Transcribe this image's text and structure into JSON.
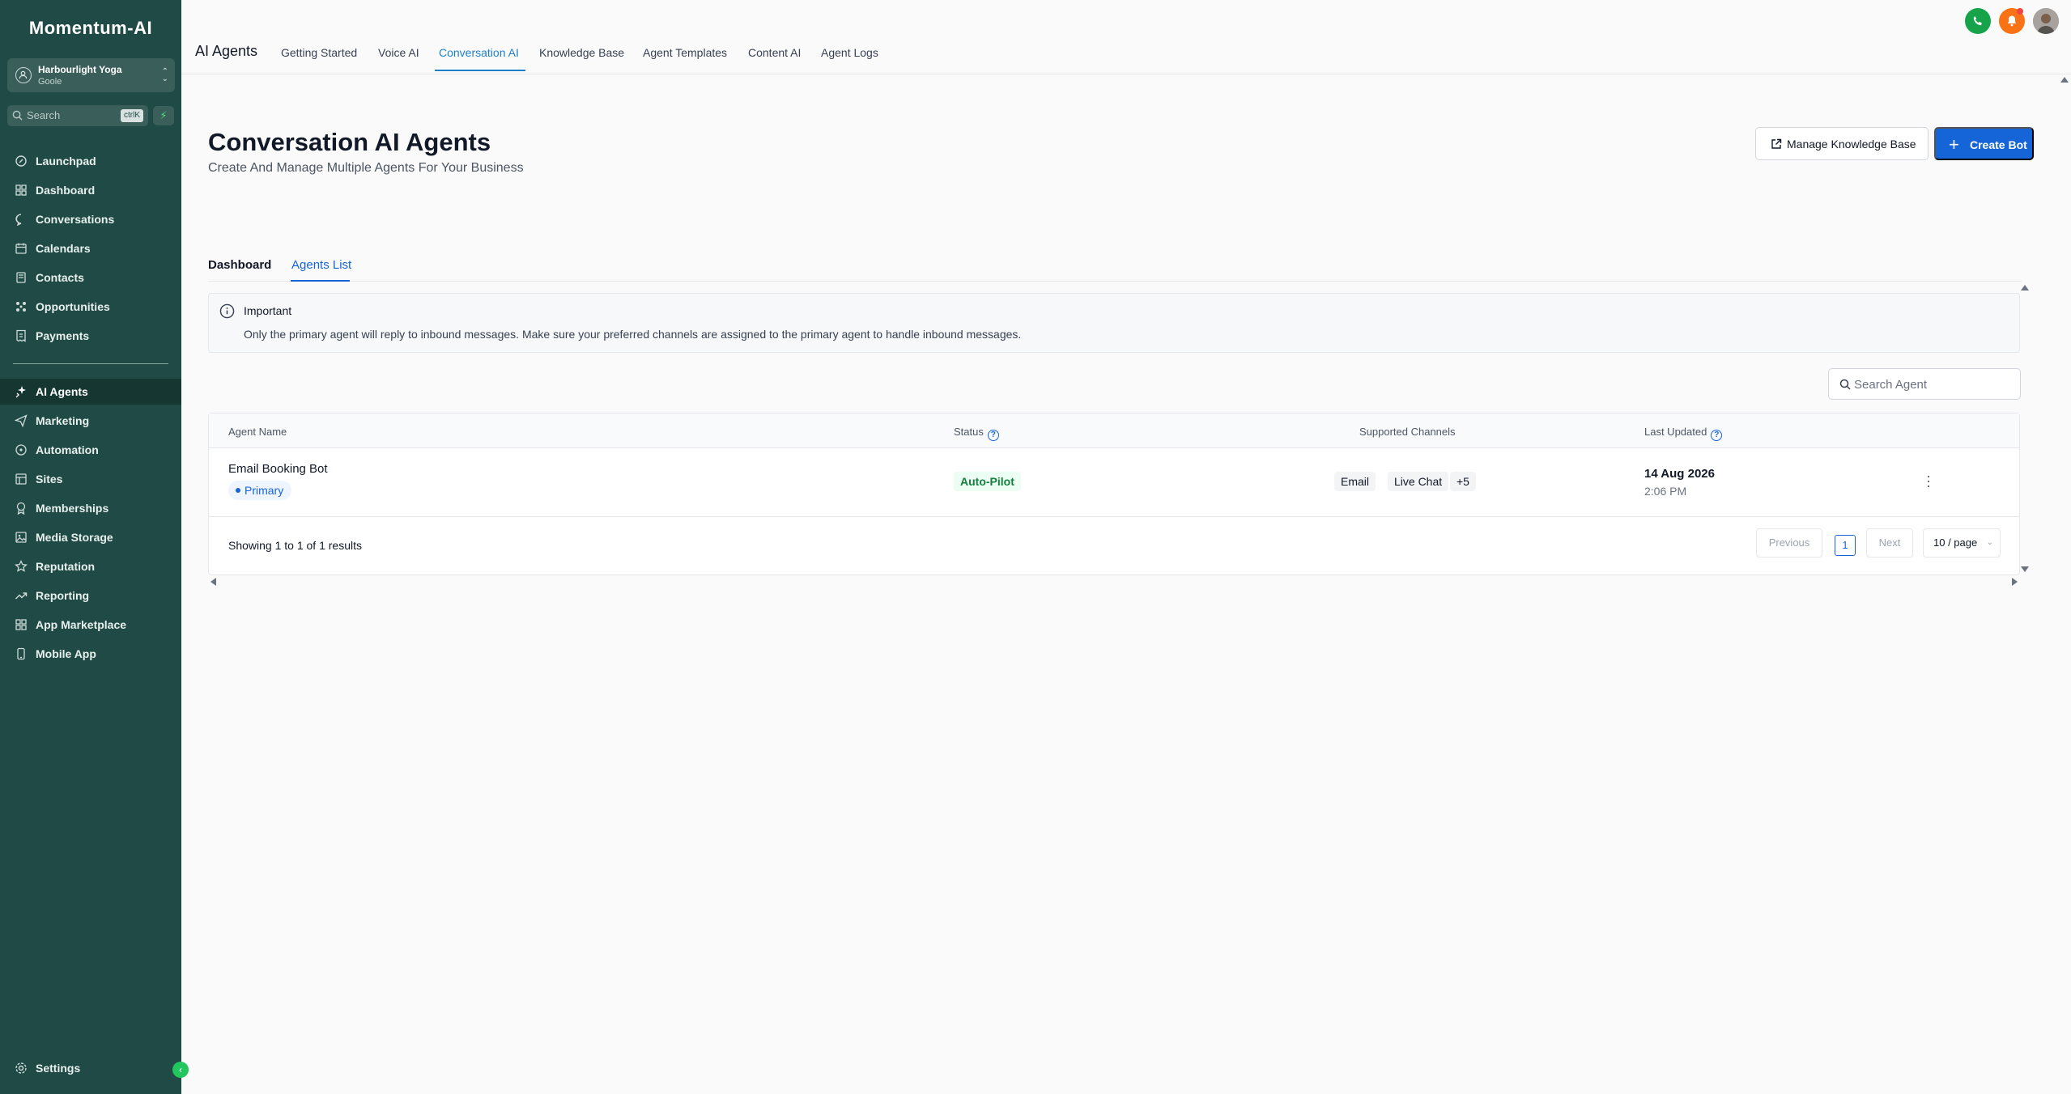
{
  "app": {
    "logo": "Momentum-AI"
  },
  "account": {
    "name": "Harbourlight Yoga",
    "location": "Goole"
  },
  "sidebar": {
    "search_placeholder": "Search",
    "search_shortcut": "ctrlK",
    "items": [
      {
        "label": "Launchpad",
        "icon": "rocket-icon"
      },
      {
        "label": "Dashboard",
        "icon": "grid-icon"
      },
      {
        "label": "Conversations",
        "icon": "chat-bubble-icon"
      },
      {
        "label": "Calendars",
        "icon": "calendar-icon"
      },
      {
        "label": "Contacts",
        "icon": "contacts-icon"
      },
      {
        "label": "Opportunities",
        "icon": "opportunities-icon"
      },
      {
        "label": "Payments",
        "icon": "receipt-icon"
      },
      {
        "label": "AI Agents",
        "icon": "sparkle-icon",
        "active": true
      },
      {
        "label": "Marketing",
        "icon": "send-icon"
      },
      {
        "label": "Automation",
        "icon": "automation-icon"
      },
      {
        "label": "Sites",
        "icon": "sites-icon"
      },
      {
        "label": "Memberships",
        "icon": "award-icon"
      },
      {
        "label": "Media Storage",
        "icon": "image-icon"
      },
      {
        "label": "Reputation",
        "icon": "star-icon"
      },
      {
        "label": "Reporting",
        "icon": "trend-icon"
      },
      {
        "label": "App Marketplace",
        "icon": "apps-icon"
      },
      {
        "label": "Mobile App",
        "icon": "mobile-icon"
      }
    ],
    "settings_label": "Settings"
  },
  "topbar": {
    "title": "AI Agents",
    "tabs": [
      {
        "label": "Getting Started"
      },
      {
        "label": "Voice AI"
      },
      {
        "label": "Conversation AI",
        "active": true
      },
      {
        "label": "Knowledge Base"
      },
      {
        "label": "Agent Templates"
      },
      {
        "label": "Content AI"
      },
      {
        "label": "Agent Logs"
      }
    ]
  },
  "page": {
    "title": "Conversation AI Agents",
    "subtitle": "Create And Manage Multiple Agents For Your Business",
    "manage_kb_label": "Manage Knowledge Base",
    "create_bot_label": "Create Bot",
    "subtabs": [
      {
        "label": "Dashboard"
      },
      {
        "label": "Agents List",
        "active": true
      }
    ],
    "alert": {
      "heading": "Important",
      "body": "Only the primary agent will reply to inbound messages. Make sure your preferred channels are assigned to the primary agent to handle inbound messages."
    },
    "search_agent_placeholder": "Search Agent"
  },
  "table": {
    "columns": [
      "Agent Name",
      "Status",
      "Supported Channels",
      "Last Updated"
    ],
    "rows": [
      {
        "name": "Email Booking Bot",
        "badge": "Primary",
        "status": "Auto-Pilot",
        "channels": [
          "Email",
          "Live Chat",
          "+5"
        ],
        "date": "14 Aug 2026",
        "time": "2:06 PM"
      }
    ],
    "results_text": "Showing 1 to 1 of 1 results",
    "pagination": {
      "previous": "Previous",
      "page": "1",
      "next": "Next",
      "page_size": "10 / page"
    }
  },
  "colors": {
    "sidebar_bg": "#1f4a45",
    "accent_blue": "#1565d8",
    "tab_active": "#1e7fc9",
    "status_green": "#15803d",
    "phone_button": "#16a34a",
    "bell_button": "#f97316"
  }
}
